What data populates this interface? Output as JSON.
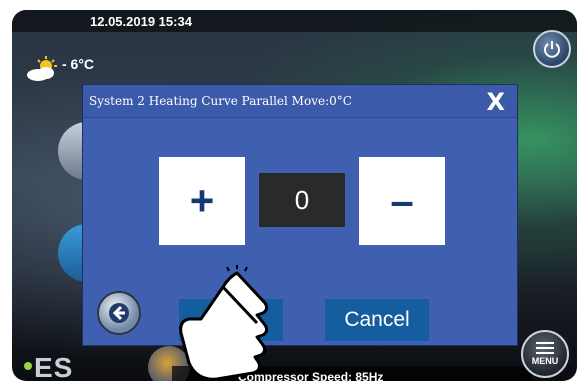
{
  "status": {
    "datetime": "12.05.2019 15:34"
  },
  "weather": {
    "icon": "partly-sunny-icon",
    "temperature": "- 6°C"
  },
  "brand": {
    "logo": "ES"
  },
  "bottom": {
    "compressor_speed": "Compressor Speed: 85Hz"
  },
  "buttons": {
    "power_icon": "power-icon",
    "menu_label": "MENU"
  },
  "dialog": {
    "title": "System 2 Heating Curve Parallel Move:0°C",
    "close_label": "X",
    "plus_label": "+",
    "minus_label": "–",
    "value": "0",
    "ok_label": "OK",
    "cancel_label": "Cancel",
    "back_icon": "arrow-left-icon"
  },
  "colors": {
    "dialog_bg": "#3f5fb1",
    "action_button": "#145ea0",
    "value_box": "#2a2a2a"
  }
}
